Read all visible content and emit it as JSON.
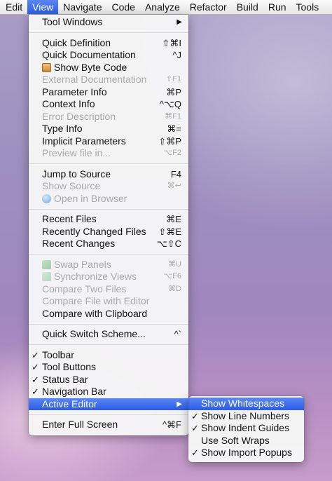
{
  "menubar": {
    "items": [
      "Edit",
      "View",
      "Navigate",
      "Code",
      "Analyze",
      "Refactor",
      "Build",
      "Run",
      "Tools"
    ],
    "active_index": 1
  },
  "view_menu": {
    "tool_windows": "Tool Windows",
    "group1": [
      {
        "label": "Quick Definition",
        "shortcut": "⇧⌘I",
        "enabled": true
      },
      {
        "label": "Quick Documentation",
        "shortcut": "^J",
        "enabled": true
      },
      {
        "label": "Show Byte Code",
        "shortcut": "",
        "enabled": true,
        "icon": "bytecode-icon"
      },
      {
        "label": "External Documentation",
        "shortcut": "⇧F1",
        "enabled": false
      },
      {
        "label": "Parameter Info",
        "shortcut": "⌘P",
        "enabled": true
      },
      {
        "label": "Context Info",
        "shortcut": "^⌥Q",
        "enabled": true
      },
      {
        "label": "Error Description",
        "shortcut": "⌘F1",
        "enabled": false
      },
      {
        "label": "Type Info",
        "shortcut": "⌘=",
        "enabled": true
      },
      {
        "label": "Implicit Parameters",
        "shortcut": "⇧⌘P",
        "enabled": true
      },
      {
        "label": "Preview file in...",
        "shortcut": "⌥F2",
        "enabled": false
      }
    ],
    "group2": [
      {
        "label": "Jump to Source",
        "shortcut": "F4",
        "enabled": true
      },
      {
        "label": "Show Source",
        "shortcut": "⌘↩",
        "enabled": false
      },
      {
        "label": "Open in Browser",
        "shortcut": "",
        "enabled": false,
        "icon": "browser-icon"
      }
    ],
    "group3": [
      {
        "label": "Recent Files",
        "shortcut": "⌘E",
        "enabled": true
      },
      {
        "label": "Recently Changed Files",
        "shortcut": "⇧⌘E",
        "enabled": true
      },
      {
        "label": "Recent Changes",
        "shortcut": "⌥⇧C",
        "enabled": true
      }
    ],
    "group4": [
      {
        "label": "Swap Panels",
        "shortcut": "⌘U",
        "enabled": false,
        "icon": "swap-panels-icon"
      },
      {
        "label": "Synchronize Views",
        "shortcut": "⌥F6",
        "enabled": false,
        "icon": "synchronize-icon"
      },
      {
        "label": "Compare Two Files",
        "shortcut": "⌘D",
        "enabled": false
      },
      {
        "label": "Compare File with Editor",
        "shortcut": "",
        "enabled": false
      },
      {
        "label": "Compare with Clipboard",
        "shortcut": "",
        "enabled": true
      }
    ],
    "quick_switch": {
      "label": "Quick Switch Scheme...",
      "shortcut": "^`"
    },
    "group5": [
      {
        "label": "Toolbar",
        "checked": true
      },
      {
        "label": "Tool Buttons",
        "checked": true
      },
      {
        "label": "Status Bar",
        "checked": true
      },
      {
        "label": "Navigation Bar",
        "checked": true
      }
    ],
    "active_editor": "Active Editor",
    "enter_full_screen": {
      "label": "Enter Full Screen",
      "shortcut": "^⌘F"
    }
  },
  "editor_submenu": {
    "items": [
      {
        "label": "Show Whitespaces",
        "checked": false,
        "highlighted": true
      },
      {
        "label": "Show Line Numbers",
        "checked": true,
        "highlighted": false
      },
      {
        "label": "Show Indent Guides",
        "checked": true,
        "highlighted": false
      },
      {
        "label": "Use Soft Wraps",
        "checked": false,
        "highlighted": false
      },
      {
        "label": "Show Import Popups",
        "checked": true,
        "highlighted": false
      }
    ]
  },
  "symbols": {
    "submenu_arrow": "▶",
    "check": "✓"
  }
}
